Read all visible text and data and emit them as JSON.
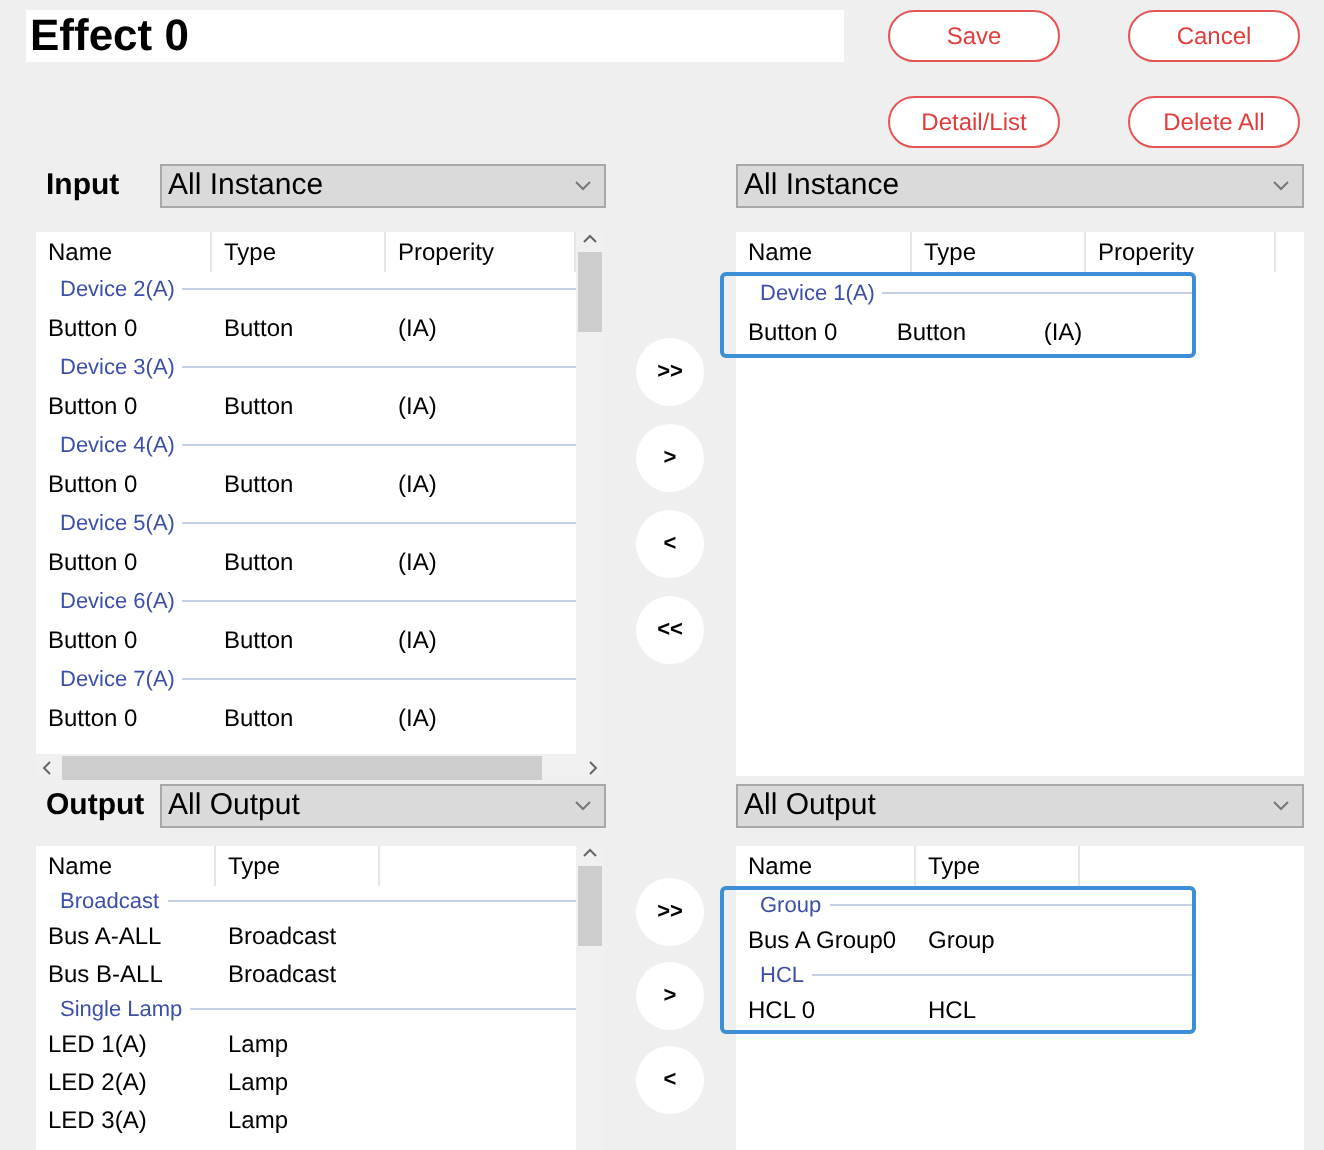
{
  "title": "Effect 0",
  "buttons": [
    {
      "label": "Save"
    },
    {
      "label": "Cancel"
    },
    {
      "label": "Detail/List"
    },
    {
      "label": "Delete All"
    }
  ],
  "sections": [
    {
      "label": "Input",
      "filter": "All Instance",
      "target_filter": "All Instance",
      "columns": [
        "Name",
        "Type",
        "Properity"
      ],
      "target_columns": [
        "Name",
        "Type",
        "Properity"
      ],
      "scroll_horizontal": true,
      "move_buttons": [
        ">>",
        ">",
        "<",
        "<<"
      ],
      "source": {
        "groups": [
          {
            "title": "Device 2(A)",
            "items": [
              {
                "cells": [
                  "Button 0",
                  "Button",
                  "(IA)"
                ]
              }
            ]
          },
          {
            "title": "Device 3(A)",
            "items": [
              {
                "cells": [
                  "Button 0",
                  "Button",
                  "(IA)"
                ]
              }
            ]
          },
          {
            "title": "Device 4(A)",
            "items": [
              {
                "cells": [
                  "Button 0",
                  "Button",
                  "(IA)"
                ]
              }
            ]
          },
          {
            "title": "Device 5(A)",
            "items": [
              {
                "cells": [
                  "Button 0",
                  "Button",
                  "(IA)"
                ]
              }
            ]
          },
          {
            "title": "Device 6(A)",
            "items": [
              {
                "cells": [
                  "Button 0",
                  "Button",
                  "(IA)"
                ]
              }
            ]
          },
          {
            "title": "Device 7(A)",
            "items": [
              {
                "cells": [
                  "Button 0",
                  "Button",
                  "(IA)"
                ]
              }
            ]
          }
        ]
      },
      "target": {
        "highlighted": true,
        "groups": [
          {
            "title": "Device 1(A)",
            "items": [
              {
                "cells": [
                  "Button 0",
                  "Button",
                  "(IA)"
                ]
              }
            ]
          }
        ]
      }
    },
    {
      "label": "Output",
      "filter": "All Output",
      "target_filter": "All Output",
      "columns": [
        "Name",
        "Type"
      ],
      "target_columns": [
        "Name",
        "Type"
      ],
      "scroll_horizontal": false,
      "move_buttons": [
        ">>",
        ">",
        "<"
      ],
      "source": {
        "groups": [
          {
            "title": "Broadcast",
            "items": [
              {
                "cells": [
                  "Bus A-ALL",
                  "Broadcast"
                ]
              },
              {
                "cells": [
                  "Bus B-ALL",
                  "Broadcast"
                ]
              }
            ]
          },
          {
            "title": "Single Lamp",
            "items": [
              {
                "cells": [
                  "LED 1(A)",
                  "Lamp"
                ]
              },
              {
                "cells": [
                  "LED 2(A)",
                  "Lamp"
                ]
              },
              {
                "cells": [
                  "LED 3(A)",
                  "Lamp"
                ]
              }
            ]
          }
        ]
      },
      "target": {
        "highlighted": true,
        "groups": [
          {
            "title": "Group",
            "items": [
              {
                "cells": [
                  "Bus A Group0",
                  "Group"
                ]
              }
            ]
          },
          {
            "title": "HCL",
            "items": [
              {
                "cells": [
                  "HCL 0",
                  "HCL"
                ]
              }
            ]
          }
        ]
      }
    }
  ]
}
